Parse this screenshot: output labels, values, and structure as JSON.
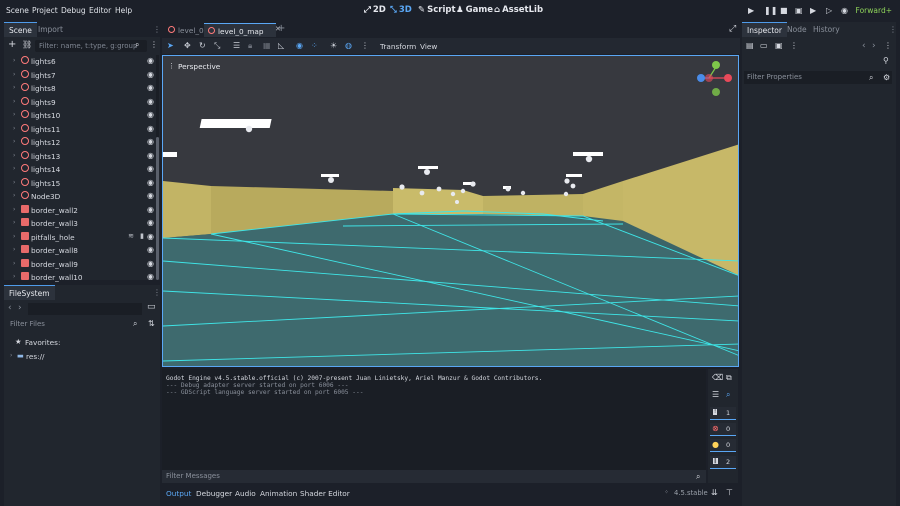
{
  "menu": {
    "items": [
      "Scene",
      "Project",
      "Debug",
      "Editor",
      "Help"
    ]
  },
  "workspaces": {
    "2d": "2D",
    "3d": "3D",
    "script": "Script",
    "game": "Game",
    "assetlib": "AssetLib"
  },
  "renderer": "Forward+",
  "scene_dock": {
    "tabs": [
      "Scene",
      "Import"
    ],
    "filter_placeholder": "Filter: name, t:type, g:group",
    "nodes": [
      {
        "label": "lights6",
        "kind": "node3d"
      },
      {
        "label": "lights7",
        "kind": "node3d"
      },
      {
        "label": "lights8",
        "kind": "node3d"
      },
      {
        "label": "lights9",
        "kind": "node3d"
      },
      {
        "label": "lights10",
        "kind": "node3d"
      },
      {
        "label": "lights11",
        "kind": "node3d"
      },
      {
        "label": "lights12",
        "kind": "node3d"
      },
      {
        "label": "lights13",
        "kind": "node3d"
      },
      {
        "label": "lights14",
        "kind": "node3d"
      },
      {
        "label": "lights15",
        "kind": "node3d"
      },
      {
        "label": "Node3D",
        "kind": "node3d"
      },
      {
        "label": "border_wall2",
        "kind": "mesh"
      },
      {
        "label": "border_wall3",
        "kind": "mesh"
      },
      {
        "label": "pitfalls_hole",
        "kind": "mesh"
      },
      {
        "label": "border_wall8",
        "kind": "mesh"
      },
      {
        "label": "border_wall9",
        "kind": "mesh"
      },
      {
        "label": "border_wall10",
        "kind": "mesh"
      }
    ]
  },
  "filesystem": {
    "tab": "FileSystem",
    "filter_placeholder": "Filter Files",
    "favorites": "Favorites:",
    "root": "res://"
  },
  "editor_tabs": [
    {
      "label": "level_0",
      "active": false
    },
    {
      "label": "level_0_map",
      "active": true
    }
  ],
  "viewport_toolbar": {
    "transform": "Transform",
    "view": "View"
  },
  "viewport": {
    "label": "Perspective"
  },
  "output": {
    "lines": [
      {
        "text": "Godot Engine v4.5.stable.official (c) 2007-present Juan Linietsky, Ariel Manzur & Godot Contributors.",
        "color": "#d6d9e0"
      },
      {
        "text": "--- Debug adapter server started on port 6006 ---",
        "color": "#8a909b"
      },
      {
        "text": "--- GDScript language server started on port 6005 ---",
        "color": "#8a909b"
      }
    ],
    "filter_placeholder": "Filter Messages",
    "counts": {
      "messages": "1",
      "errors": "0",
      "warnings": "0",
      "editor": "2"
    }
  },
  "bottom_tabs": [
    "Output",
    "Debugger",
    "Audio",
    "Animation",
    "Shader Editor"
  ],
  "version": "4.5.stable",
  "inspector": {
    "tabs": [
      "Inspector",
      "Node",
      "History"
    ],
    "filter_placeholder": "Filter Properties"
  },
  "colors": {
    "accent": "#5aa7f5",
    "node_icon": "#ff7a7a",
    "mesh_icon": "#e86a6a",
    "wall": "#c7b868",
    "floor": "#3e6a6e",
    "ceiling": "#383b41",
    "wire": "#3ee6e8"
  }
}
